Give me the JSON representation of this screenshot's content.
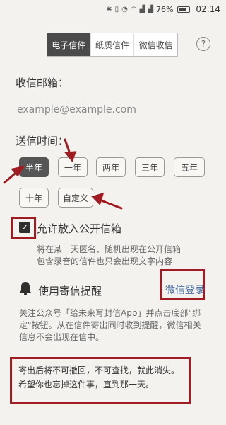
{
  "status": {
    "battery": "76%",
    "time": "02:14"
  },
  "tabs": [
    {
      "label": "电子信件",
      "active": true
    },
    {
      "label": "纸质信件",
      "active": false
    },
    {
      "label": "微信收信",
      "active": false
    }
  ],
  "help_label": "?",
  "email": {
    "label": "收信邮箱：",
    "placeholder": "example@example.com"
  },
  "send_time": {
    "label": "送信时间：",
    "options": [
      "半年",
      "一年",
      "两年",
      "三年",
      "五年",
      "十年",
      "自定义"
    ],
    "selected": "半年"
  },
  "public_box": {
    "label": "允许放入公开信箱",
    "checked": true,
    "desc1": "将在某一天匿名、随机出现在公开信箱",
    "desc2": "包含录音的信件也只会出现文字内容"
  },
  "reminder": {
    "label": "使用寄信提醒",
    "link": "微信登录",
    "desc1": "关注公众号「给未来写封信App」并点击底部\"绑",
    "desc2": "定\"按钮。从在信件寄出同时收到提醒，微信相关",
    "desc3": "信息不会出现在信中。"
  },
  "warning": {
    "line1": "寄出后将不可撤回，不可查找，就此消失。",
    "line2": "希望你也忘掉这件事，直到那一天。"
  },
  "colors": {
    "annotation_red": "#a01c22",
    "link_blue": "#4c6fa3",
    "active_dark": "#4a4a4a"
  }
}
